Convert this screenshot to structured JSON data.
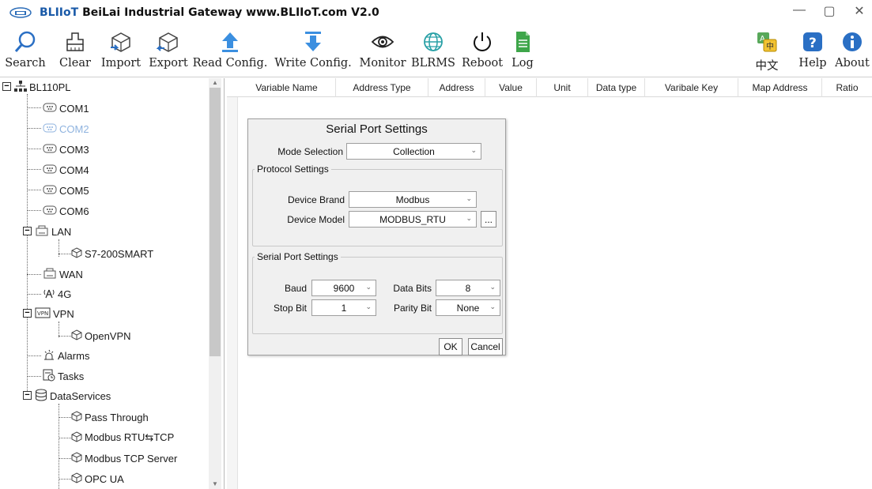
{
  "window": {
    "brand": "BLIIoT",
    "title_rest": "BeiLai Industrial Gateway www.BLIIoT.com V2.0",
    "controls": [
      "—",
      "▢",
      "✕"
    ]
  },
  "toolbar": {
    "search": "Search",
    "clear": "Clear",
    "import": "Import",
    "export": "Export",
    "read_config": "Read Config.",
    "write_config": "Write Config.",
    "monitor": "Monitor",
    "blrms": "BLRMS",
    "reboot": "Reboot",
    "log": "Log",
    "language": "中文",
    "help": "Help",
    "about": "About"
  },
  "tree": {
    "root": "BL110PL",
    "com1": "COM1",
    "com2": "COM2",
    "com3": "COM3",
    "com4": "COM4",
    "com5": "COM5",
    "com6": "COM6",
    "lan": "LAN",
    "s7": "S7-200SMART",
    "wan": "WAN",
    "fourg": "4G",
    "vpn": "VPN",
    "openvpn": "OpenVPN",
    "alarms": "Alarms",
    "tasks": "Tasks",
    "dataservices": "DataServices",
    "passthrough": "Pass Through",
    "modbus_rtu_tcp": "Modbus RTU⇆TCP",
    "modbus_tcp_server": "Modbus TCP Server",
    "opcua": "OPC UA"
  },
  "grid": {
    "columns": [
      "Variable Name",
      "Address Type",
      "Address",
      "Value",
      "Unit",
      "Data type",
      "Varibale Key",
      "Map Address",
      "Ratio"
    ]
  },
  "dialog": {
    "title": "Serial Port Settings",
    "mode_label": "Mode Selection",
    "mode_value": "Collection",
    "protocol_group": "Protocol Settings",
    "brand_label": "Device Brand",
    "brand_value": "Modbus",
    "model_label": "Device Model",
    "model_value": "MODBUS_RTU",
    "more_btn": "...",
    "serial_group": "Serial Port Settings",
    "baud_label": "Baud",
    "baud_value": "9600",
    "databits_label": "Data Bits",
    "databits_value": "8",
    "stopbit_label": "Stop Bit",
    "stopbit_value": "1",
    "parity_label": "Parity Bit",
    "parity_value": "None",
    "ok": "OK",
    "cancel": "Cancel"
  },
  "colors": {
    "brand_blue": "#1a5aa8",
    "selected_node": "#8fb3df",
    "dialog_bg": "#f0f0f0"
  }
}
